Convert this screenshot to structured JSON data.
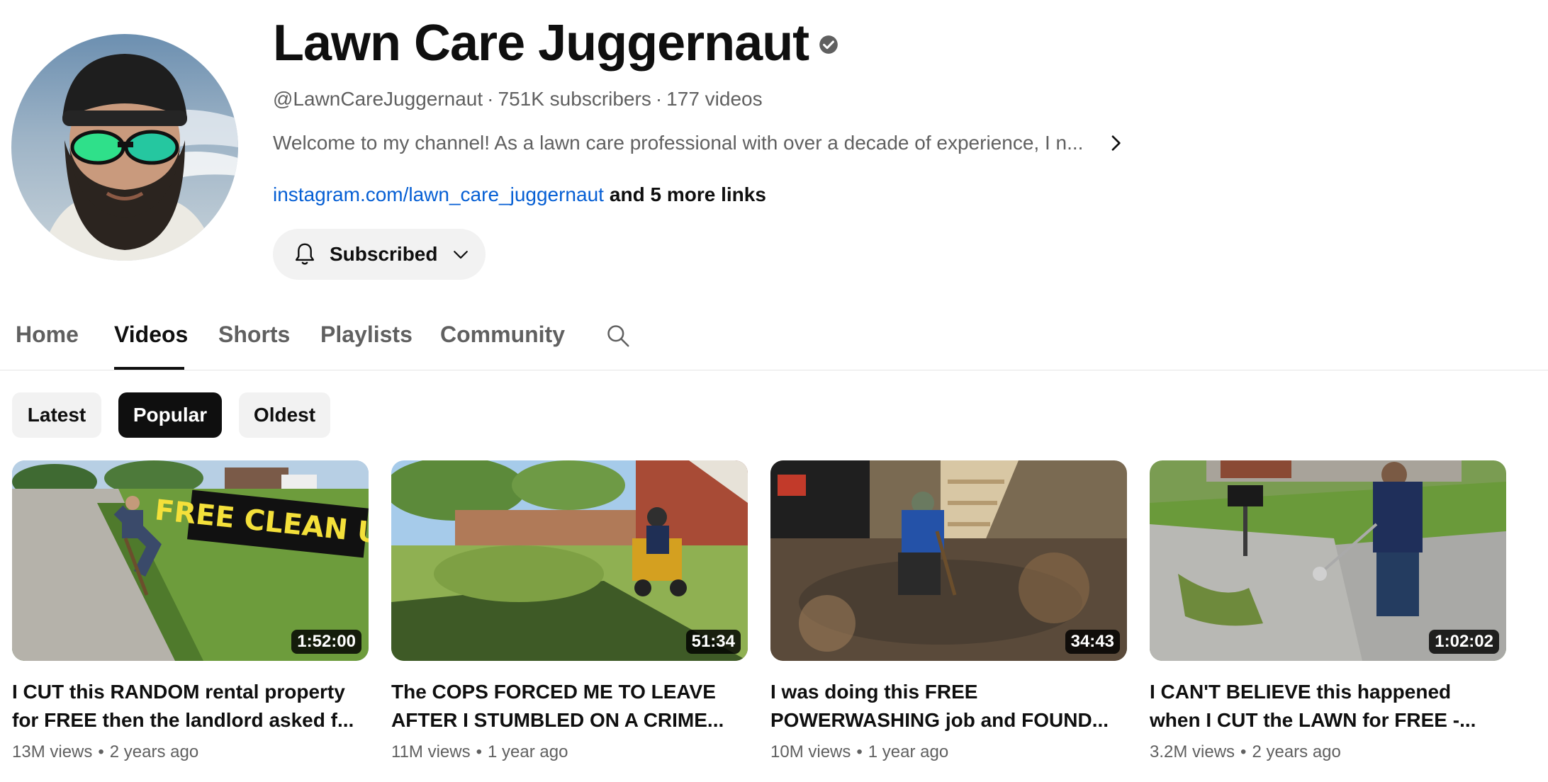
{
  "channel": {
    "title": "Lawn Care Juggernaut",
    "verified_icon": "verified-check-icon",
    "handle": "@LawnCareJuggernaut",
    "subscribers": "751K subscribers",
    "video_count": "177 videos",
    "separator": "·",
    "description": "Welcome to my channel! As a lawn care professional with over a decade of experience, I n...",
    "link_primary": "instagram.com/lawn_care_juggernaut",
    "link_more": "and 5 more links",
    "subscribe_label": "Subscribed"
  },
  "tabs": [
    {
      "label": "Home",
      "active": false
    },
    {
      "label": "Videos",
      "active": true
    },
    {
      "label": "Shorts",
      "active": false
    },
    {
      "label": "Playlists",
      "active": false
    },
    {
      "label": "Community",
      "active": false
    }
  ],
  "filters": [
    {
      "label": "Latest",
      "active": false
    },
    {
      "label": "Popular",
      "active": true
    },
    {
      "label": "Oldest",
      "active": false
    }
  ],
  "videos": [
    {
      "title_line1": "I CUT this RANDOM rental property",
      "title_line2": "for FREE then the landlord asked f...",
      "duration": "1:52:00",
      "views": "13M views",
      "age": "2 years ago",
      "thumb_overlay": "FREE CLEAN UP"
    },
    {
      "title_line1": "The COPS FORCED ME TO LEAVE",
      "title_line2": "AFTER I STUMBLED ON A CRIME...",
      "duration": "51:34",
      "views": "11M views",
      "age": "1 year ago"
    },
    {
      "title_line1": "I was doing this FREE",
      "title_line2": "POWERWASHING job and FOUND...",
      "duration": "34:43",
      "views": "10M views",
      "age": "1 year ago"
    },
    {
      "title_line1": "I CAN'T BELIEVE this happened",
      "title_line2": "when I CUT the LAWN for FREE -...",
      "duration": "1:02:02",
      "views": "3.2M views",
      "age": "2 years ago"
    }
  ],
  "meta_dot": "•",
  "colors": {
    "link": "#065fd4",
    "text_primary": "#0f0f0f",
    "text_secondary": "#606060",
    "chip_bg": "#f2f2f2",
    "chip_active_bg": "#0f0f0f"
  }
}
